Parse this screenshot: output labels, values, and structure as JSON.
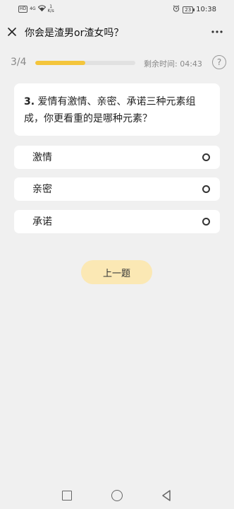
{
  "status_bar": {
    "signal_box": "HD",
    "signal_text": "4G",
    "speed_value": "1",
    "speed_unit": "K/s",
    "battery": "23",
    "time": "10:38"
  },
  "header": {
    "title": "你会是渣男or渣女吗？",
    "more_label": "···"
  },
  "progress": {
    "label": "3/4",
    "fraction": 0.5,
    "time_label": "剩余时间: 04:43",
    "help_label": "?"
  },
  "question": {
    "number": "3.",
    "text": "爱情有激情、亲密、承诺三种元素组成，你更看重的是哪种元素？"
  },
  "options": [
    {
      "label": "激情"
    },
    {
      "label": "亲密"
    },
    {
      "label": "承诺"
    }
  ],
  "prev_button": "上一题",
  "colors": {
    "accent": "#f4c53c",
    "button_bg": "#fbe8b4",
    "background": "#f0f0f0"
  },
  "icons": {
    "close": "close-icon",
    "more": "more-icon",
    "help": "help-icon",
    "nav_recent": "square-icon",
    "nav_home": "circle-icon",
    "nav_back": "triangle-back-icon"
  }
}
